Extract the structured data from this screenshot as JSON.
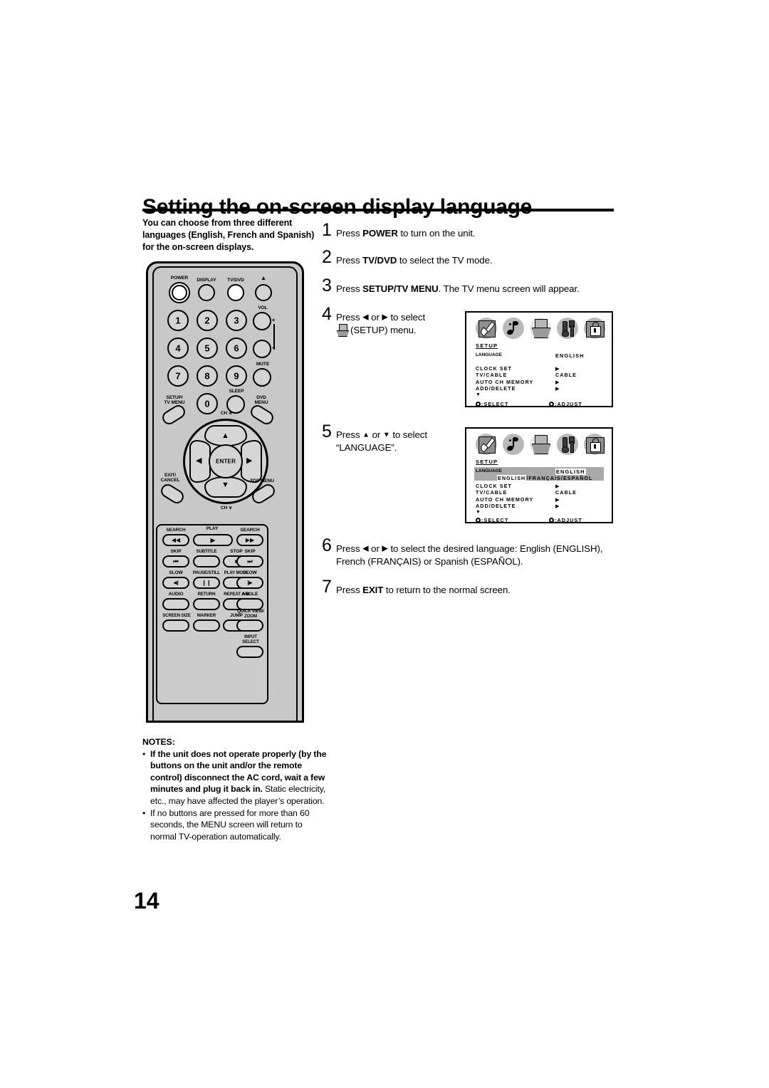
{
  "page": {
    "title": "Setting the on-screen display language",
    "number": "14",
    "intro": "You can choose from three different languages (English, French and Spanish) for the on-screen displays."
  },
  "steps": [
    {
      "num": "1",
      "html": "Press <b>POWER</b> to turn on the unit."
    },
    {
      "num": "2",
      "html": "Press <b>TV/DVD</b> to select the TV mode."
    },
    {
      "num": "3",
      "html": "Press <b>SETUP/TV MENU</b>. The TV menu screen will appear."
    },
    {
      "num": "4",
      "html": "Press <span class=\"arrowglyph\">&#9664;</span> or <span class=\"arrowglyph\">&#9654;</span> to select<br><span class=\"inline-setup\"><span class=\"lid\"></span><span class=\"tray\"></span></span>(SETUP) menu."
    },
    {
      "num": "5",
      "html": "Press <span class=\"arrowglyph up\">&#9650;</span> or <span class=\"arrowglyph up\">&#9660;</span> to select<br>&ldquo;LANGUAGE&rdquo;."
    },
    {
      "num": "6",
      "html": "Press <span class=\"arrowglyph\">&#9664;</span> or <span class=\"arrowglyph\">&#9654;</span> to select the desired language: English (ENGLISH),<br>French (FRAN&Ccedil;AIS) or Spanish (ESPA&Ntilde;OL)."
    },
    {
      "num": "7",
      "html": "Press <b>EXIT</b> to return to the normal screen."
    }
  ],
  "osd": {
    "icons": [
      "picture-icon",
      "audio-icon",
      "setup-icon",
      "tools-icon",
      "lock-icon"
    ],
    "menu_title": "SETUP",
    "language_label": "LANGUAGE",
    "language_value": "ENGLISH",
    "language_choices_prefix": "ENGLISH",
    "language_choices_rest": "/FRANÇAIS/ESPAÑOL",
    "rows": [
      {
        "key": "CLOCK SET",
        "value": "▶"
      },
      {
        "key": "TV/CABLE",
        "value": "CABLE"
      },
      {
        "key": "AUTO CH MEMORY",
        "value": "▶"
      },
      {
        "key": "ADD/DELETE",
        "value": "▶"
      }
    ],
    "more_indicator": "▼",
    "foot_select": ":SELECT",
    "foot_adjust": ":ADJUST"
  },
  "remote": {
    "labels": {
      "power": "POWER",
      "display": "DISPLAY",
      "tvdvd": "TV/DVD",
      "eject": "▲",
      "vol": "VOL",
      "vol_plus": "+",
      "vol_minus": "–",
      "mute": "MUTE",
      "sleep": "SLEEP",
      "setup_tv_menu": "SETUP/\nTV MENU",
      "setup_line1": "SETUP/",
      "setup_line2": "TV MENU",
      "dvd_menu_line1": "DVD",
      "dvd_menu_line2": "MENU",
      "ch_up": "CH",
      "ch_down": "CH",
      "enter": "ENTER",
      "exit_line1": "EXIT/",
      "exit_line2": "CANCEL",
      "top_menu": "TOP MENU",
      "search_left": "SEARCH",
      "play": "PLAY",
      "search_right": "SEARCH",
      "skip_left": "SKIP",
      "subtitle": "SUBTITLE",
      "stop": "STOP",
      "skip_right": "SKIP",
      "slow_left": "SLOW",
      "pause_still": "PAUSE/STILL",
      "play_mode": "PLAY MODE",
      "slow_right": "SLOW",
      "audio": "AUDIO",
      "return": "RETURN",
      "repeat_ab": "REPEAT A-B",
      "angle": "ANGLE",
      "screen_size": "SCREEN SIZE",
      "marker": "MARKER",
      "jump": "JUMP",
      "quick_view_line1": "QUICK VIEW/",
      "quick_view_line2": "ZOOM",
      "input_select_line1": "INPUT",
      "input_select_line2": "SELECT"
    },
    "numbers": [
      "1",
      "2",
      "3",
      "4",
      "5",
      "6",
      "7",
      "8",
      "9",
      "0"
    ]
  },
  "notes": {
    "heading": "NOTES:",
    "items": [
      "<b>If the unit does not operate properly (by the buttons on the unit and/or the remote control) disconnect the AC cord, wait a few minutes and plug it back in.</b> Static electricity, etc., may have affected the player&rsquo;s operation.",
      "If no buttons are pressed for more than 60 seconds, the MENU screen will return to normal TV-operation automatically."
    ]
  }
}
